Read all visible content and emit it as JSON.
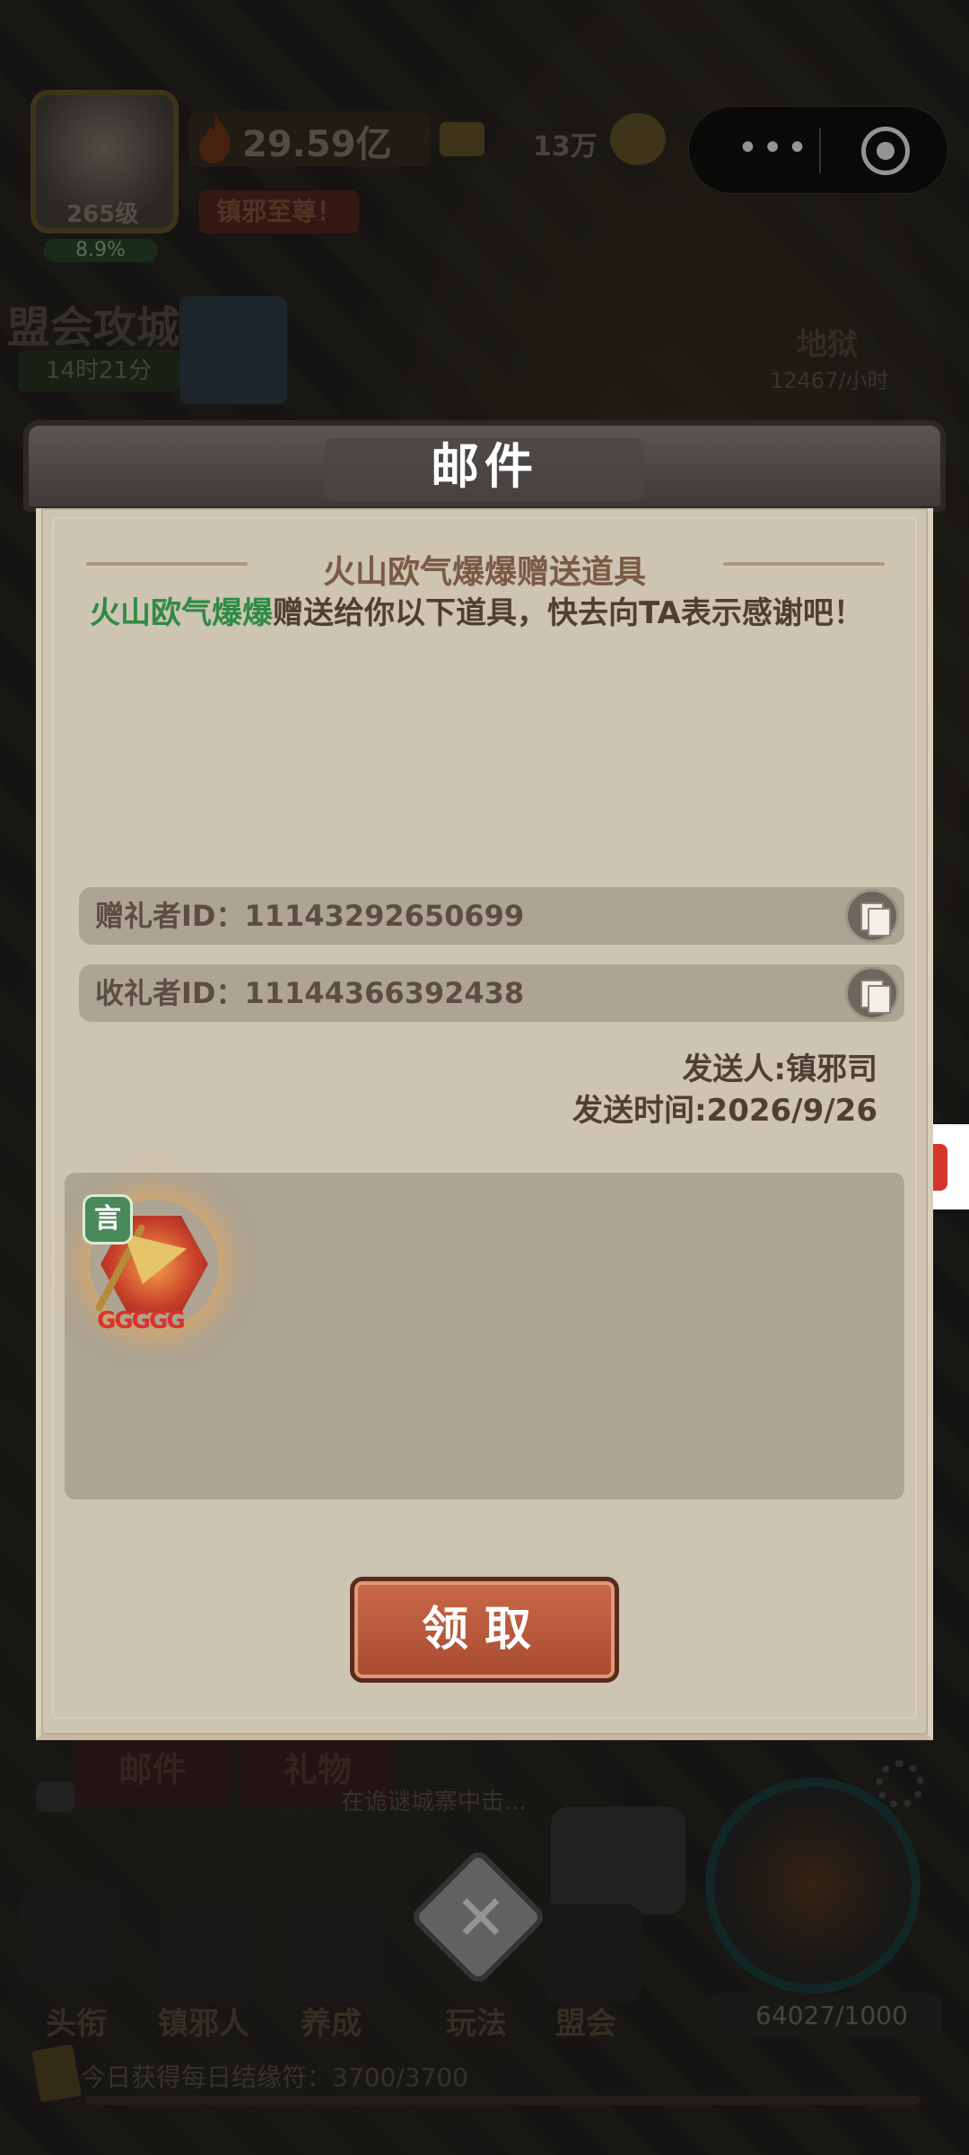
{
  "status": {
    "power": "29.59亿",
    "gold": "13万",
    "level": "265级",
    "progress_pct": "8.9%",
    "title": "镇邪至尊！"
  },
  "event": {
    "name": "盟会攻城战",
    "timer": "14时21分"
  },
  "hell": {
    "label": "地狱",
    "rate": "12467/小时"
  },
  "mini_program": {
    "dots": "•••"
  },
  "dialog": {
    "title": "邮件",
    "subject": "火山欧气爆爆赠送道具",
    "sender_name": "火山欧气爆爆",
    "message": "赠送给你以下道具，快去向TA表示感谢吧！",
    "giver_id": "赠礼者ID：11143292650699",
    "receiver_id": "收礼者ID：11144366392438",
    "from": "发送人:镇邪司",
    "time": "发送时间:2026/9/26",
    "item": {
      "badge": "言",
      "stars": "GGGGG"
    },
    "claim_label": "领取"
  },
  "bottom": {
    "tabs": [
      "邮件",
      "礼物"
    ],
    "chat": "在诡谜城寨中击...",
    "nav": [
      "头衔",
      "镇邪人",
      "养成",
      "玩法",
      "盟会"
    ],
    "score": "64027/1000",
    "daily": "今日获得每日结缘符：3700/3700"
  },
  "colors": {
    "sender_green": "#2f8a46",
    "claim_button": "#b85a3a",
    "panel_bg": "#cdc4b1"
  }
}
